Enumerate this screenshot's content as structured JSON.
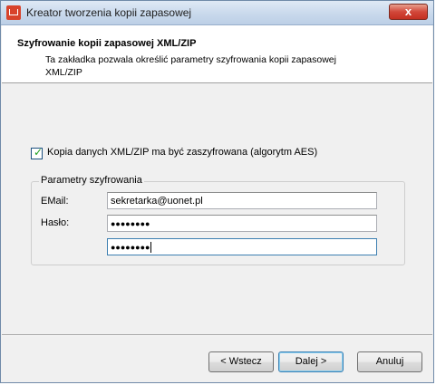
{
  "window": {
    "title": "Kreator tworzenia kopii zapasowej",
    "close_label": "x"
  },
  "header": {
    "title": "Szyfrowanie kopii zapasowej XML/ZIP",
    "subtitle": "Ta zakładka pozwala określić parametry szyfrowania kopii zapasowej XML/ZIP"
  },
  "encrypt_checkbox": {
    "label": "Kopia danych XML/ZIP ma być zaszyfrowana (algorytm AES)",
    "checked": true
  },
  "group": {
    "legend": "Parametry szyfrowania",
    "email_label": "EMail:",
    "email_value": "sekretarka@uonet.pl",
    "password_label": "Hasło:",
    "password_mask": "●●●●●●●●",
    "password_repeat_mask": "●●●●●●●●"
  },
  "buttons": {
    "back": "< Wstecz",
    "next": "Dalej >",
    "cancel": "Anuluj"
  },
  "colors": {
    "title_gradient": "#c9d9ec",
    "close_red": "#d2473a",
    "check_green": "#21a121",
    "focus_border": "#3c7fb1"
  }
}
